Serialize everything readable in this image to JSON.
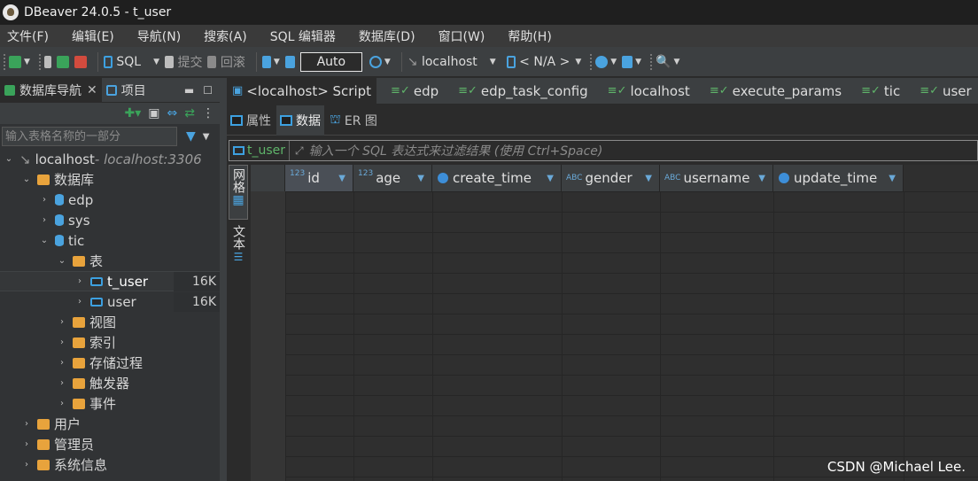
{
  "window": {
    "title": "DBeaver 24.0.5 - t_user"
  },
  "menu": [
    "文件(F)",
    "编辑(E)",
    "导航(N)",
    "搜索(A)",
    "SQL 编辑器",
    "数据库(D)",
    "窗口(W)",
    "帮助(H)"
  ],
  "toolbar": {
    "sql_label": "SQL",
    "commit_label": "提交",
    "rollback_label": "回滚",
    "transaction_mode": "Auto",
    "datasource": "localhost",
    "schema": "< N/A >"
  },
  "left_panel": {
    "tabs": [
      "数据库导航",
      "项目"
    ],
    "filter_placeholder": "输入表格名称的一部分",
    "tree": [
      {
        "label": "localhost",
        "extra": " - localhost:3306",
        "level": 0,
        "icon": "server-icon",
        "expanded": true
      },
      {
        "label": "数据库",
        "level": 1,
        "icon": "database-folder-icon",
        "expanded": true
      },
      {
        "label": "edp",
        "level": 2,
        "icon": "database-icon",
        "expanded": false
      },
      {
        "label": "sys",
        "level": 2,
        "icon": "database-icon",
        "expanded": false
      },
      {
        "label": "tic",
        "level": 2,
        "icon": "database-icon",
        "expanded": true
      },
      {
        "label": "表",
        "level": 3,
        "icon": "tables-folder-icon",
        "expanded": true
      },
      {
        "label": "t_user",
        "level": 4,
        "icon": "table-icon",
        "expanded": false,
        "size": "16K",
        "selected": true
      },
      {
        "label": "user",
        "level": 4,
        "icon": "table-icon",
        "expanded": false,
        "size": "16K"
      },
      {
        "label": "视图",
        "level": 3,
        "icon": "views-folder-icon",
        "expanded": false
      },
      {
        "label": "索引",
        "level": 3,
        "icon": "folder-icon",
        "expanded": false
      },
      {
        "label": "存储过程",
        "level": 3,
        "icon": "folder-icon",
        "expanded": false
      },
      {
        "label": "触发器",
        "level": 3,
        "icon": "folder-icon",
        "expanded": false
      },
      {
        "label": "事件",
        "level": 3,
        "icon": "folder-icon",
        "expanded": false
      },
      {
        "label": "用户",
        "level": 1,
        "icon": "users-folder-icon",
        "expanded": false
      },
      {
        "label": "管理员",
        "level": 1,
        "icon": "admin-folder-icon",
        "expanded": false
      },
      {
        "label": "系统信息",
        "level": 1,
        "icon": "info-folder-icon",
        "expanded": false
      }
    ]
  },
  "editor_tabs": [
    "<localhost> Script",
    "edp",
    "edp_task_config",
    "localhost",
    "execute_params",
    "tic",
    "user"
  ],
  "sub_tabs": [
    "属性",
    "数据",
    "ER 图"
  ],
  "filter": {
    "table_chip": "t_user",
    "placeholder": "输入一个 SQL 表达式来过滤结果 (使用 Ctrl+Space)"
  },
  "vertical_tabs": {
    "grid": "网格",
    "text": "文本"
  },
  "columns": [
    {
      "name": "id",
      "type": "123",
      "kind": "number"
    },
    {
      "name": "age",
      "type": "123",
      "kind": "number"
    },
    {
      "name": "create_time",
      "type": "",
      "kind": "time"
    },
    {
      "name": "gender",
      "type": "ABC",
      "kind": "text"
    },
    {
      "name": "username",
      "type": "ABC",
      "kind": "text"
    },
    {
      "name": "update_time",
      "type": "",
      "kind": "time"
    }
  ],
  "watermark": "CSDN @Michael Lee."
}
